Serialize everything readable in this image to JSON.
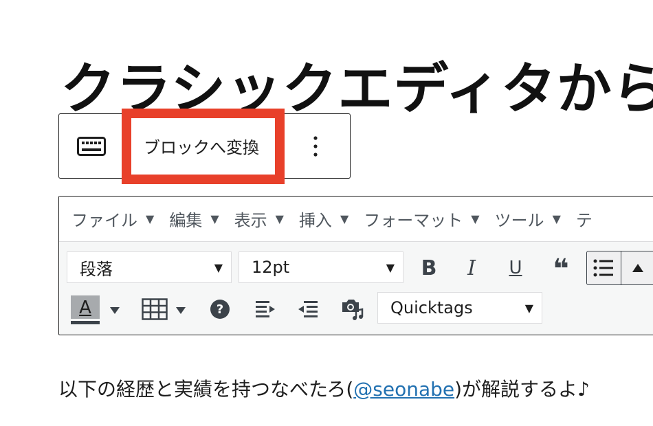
{
  "page": {
    "title": "クラシックエディタからの"
  },
  "block_toolbar": {
    "keyboard_icon": "keyboard-icon",
    "convert_label": "ブロックへ変換",
    "more_icon": "more-vertical-icon"
  },
  "highlight": {
    "color": "#e8402a"
  },
  "editor": {
    "menu": [
      {
        "label": "ファイル"
      },
      {
        "label": "編集"
      },
      {
        "label": "表示"
      },
      {
        "label": "挿入"
      },
      {
        "label": "フォーマット"
      },
      {
        "label": "ツール"
      },
      {
        "label": "テ"
      }
    ],
    "toolbar": {
      "format_select": "段落",
      "size_select": "12pt",
      "bold": "B",
      "italic": "I",
      "underline": "U",
      "blockquote": "❝",
      "text_color": "A",
      "quicktags_select": "Quicktags"
    }
  },
  "content": {
    "before": "以下の経歴と実績を持つなべたろ(",
    "link": "@seonabe",
    "after": ")が解説するよ♪"
  }
}
